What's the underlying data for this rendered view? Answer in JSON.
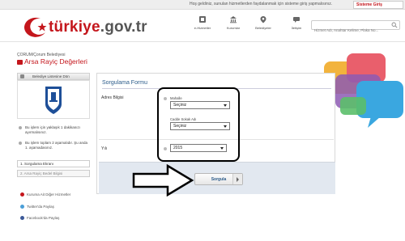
{
  "topbar": {
    "message": "Hoş geldiniz, sunulan hizmetlerden faydalanmak için sisteme giriş yapmalısınız.",
    "login_label": "Sisteme Giriş"
  },
  "header": {
    "logo_main": "türkiye",
    "logo_domain": ".gov.tr",
    "nav": [
      {
        "label": "e-Hizmetler",
        "icon": "e-services-icon"
      },
      {
        "label": "Kurumlar",
        "icon": "institutions-icon"
      },
      {
        "label": "Belediyeler",
        "icon": "municipalities-icon"
      },
      {
        "label": "İletişim",
        "icon": "contact-icon"
      }
    ],
    "search_placeholder": "Hizmet Adı, Anahtar Kelime, Plaka No..."
  },
  "page": {
    "breadcrumb": "ÇORUM/Çorum Belediyesi",
    "title": "Arsa Rayiç Değerleri"
  },
  "sidebar": {
    "head_label": "Belediye Listesine Dön",
    "notes": [
      "Bu işlem için yaklaşık 1 dakikanızı ayırmalısınız.",
      "Bu işlem toplam 2 aşamalıdır. Şu anda 1. aşamadasınız."
    ],
    "steps": [
      {
        "label": "1. Sorgulama Ekranı",
        "active": true
      },
      {
        "label": "2. Arsa Rayiç Bedel Bilgisi",
        "active": false
      }
    ],
    "links": [
      {
        "label": "Kuruma Ait Diğer Hizmetler",
        "color": "#c4161c"
      },
      {
        "label": "Twitter'da Paylaş",
        "color": "#4a9fd8"
      },
      {
        "label": "Facebook'da Paylaş",
        "color": "#3b5998"
      }
    ]
  },
  "form": {
    "title": "Sorgulama Formu",
    "adres_label": "Adres Bilgisi",
    "mahalle_label": "Mahalle",
    "mahalle_value": "Seçiniz",
    "cadde_label": "Cadde Sokak Adı",
    "cadde_value": "Seçiniz",
    "yil_label": "Yılı",
    "yil_value": "2015",
    "submit_label": "Sorgula"
  },
  "colors": {
    "brand_red": "#c4161c",
    "title_blue": "#2b5b8a"
  }
}
